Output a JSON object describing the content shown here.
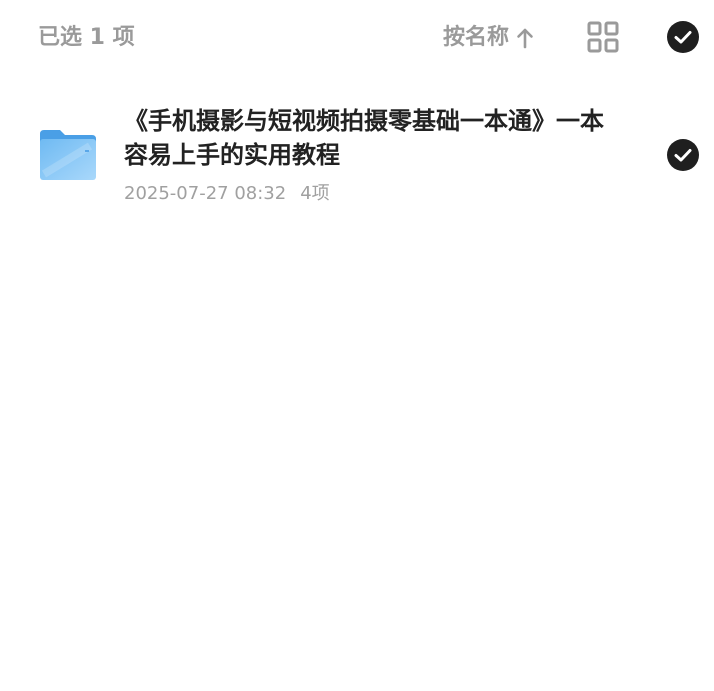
{
  "toolbar": {
    "selected_label": "已选 1 项",
    "sort_label": "按名称",
    "sort_direction_icon": "arrow-up-icon",
    "view_toggle_icon": "grid-icon",
    "select_all_icon": "check-circle-icon"
  },
  "files": [
    {
      "name": "《手机摄影与短视频拍摄零基础一本通》一本容易上手的实用教程",
      "date": "2025-07-27 08:32",
      "count": "4项",
      "icon": "folder-icon",
      "selected": true
    }
  ],
  "colors": {
    "muted_text": "#9a9a9a",
    "primary_text": "#222222",
    "meta_text": "#a0a0a0",
    "check_fill": "#1f1f1f",
    "folder_blue": "#5aaeee"
  }
}
